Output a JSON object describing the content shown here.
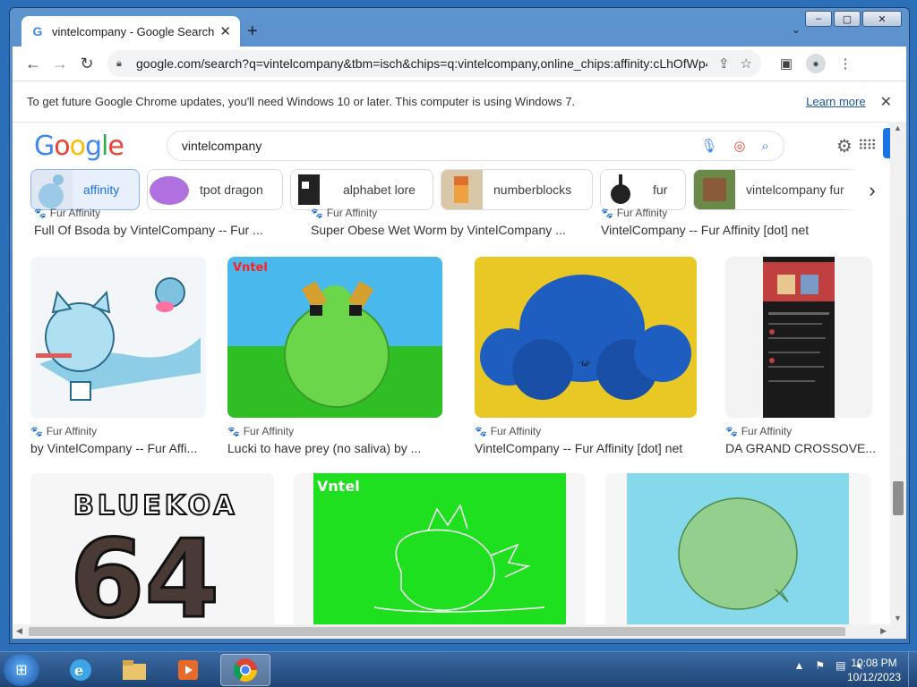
{
  "window": {
    "tab_title": "vintelcompany - Google Search",
    "controls": {
      "minimize": "–",
      "maximize": "▢",
      "close": "✕"
    }
  },
  "toolbar": {
    "url_host": "google.com",
    "url_path": "/search?q=vintelcompany&tbm=isch&chips=q:vintelcompany,online_chips:affinity:cLhOfWp4sQ..."
  },
  "infobar": {
    "message": "To get future Google Chrome updates, you'll need Windows 10 or later. This computer is using Windows 7.",
    "learn_more": "Learn more"
  },
  "google": {
    "logo": [
      "G",
      "o",
      "o",
      "g",
      "l",
      "e"
    ],
    "query": "vintelcompany"
  },
  "chips": [
    {
      "label": "affinity",
      "active": true
    },
    {
      "label": "tpot dragon",
      "active": false
    },
    {
      "label": "alphabet lore",
      "active": false
    },
    {
      "label": "numberblocks",
      "active": false
    },
    {
      "label": "fur",
      "active": false
    },
    {
      "label": "vintelcompany fur",
      "active": false
    }
  ],
  "results_top_row": [
    {
      "source": "Fur Affinity",
      "caption": "Full Of Bsoda by VintelCompany -- Fur ..."
    },
    {
      "source": "Fur Affinity",
      "caption": "Super Obese Wet Worm by VintelCompany ..."
    },
    {
      "source": "Fur Affinity",
      "caption": "VintelCompany -- Fur Affinity [dot] net"
    }
  ],
  "results_row2": [
    {
      "source": "Fur Affinity",
      "caption": "by VintelCompany -- Fur Affi..."
    },
    {
      "source": "Fur Affinity",
      "caption": "Lucki to have prey (no saliva) by ..."
    },
    {
      "source": "Fur Affinity",
      "caption": "VintelCompany -- Fur Affinity [dot] net"
    },
    {
      "source": "Fur Affinity",
      "caption": "DA GRAND CROSSOVE..."
    }
  ],
  "row3_images": {
    "bluekoa_top": "BLUEKOA",
    "bluekoa_num": "64",
    "vintel_logo": "Vntel"
  },
  "taskbar": {
    "time": "10:08 PM",
    "date": "10/12/2023"
  }
}
